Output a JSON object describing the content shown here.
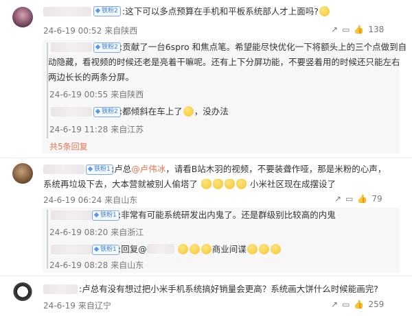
{
  "badge_label": "铁粉2",
  "badge_label_2": "铁粉1",
  "comments": [
    {
      "text": ":这下可以多点预算在手机和平板系统部人才上面吗?",
      "time": "24-6-19 00:52",
      "location": "来自陕西",
      "likes": "138"
    },
    {
      "text_prefix": ":卢总",
      "mention": "@卢伟冰",
      "text_line1": "，请看B站木羽的视频，不要装聋作哑，那是米粉的心声，",
      "text_line2": "系统再垃圾下去，大本营就被别人偷塔了",
      "text_suffix": "小米社区现在成摆设了",
      "time": "24-6-19 06:24",
      "location": "来自山东",
      "likes": "79"
    },
    {
      "text": ":卢总有没有想过把小米手机系统搞好销量会更高？系统画大饼什么时候能画完?",
      "time": "24-6-19",
      "location": "来自辽宁",
      "likes": "259"
    }
  ],
  "replies_1": [
    {
      "line1": ":贡献了一台6spro 和焦点笔。希望能尽快优化一下将额头上的三个点做到自",
      "line2": "动隐藏，看视频的时候还老是亮着干嘛呢。还有上下分屏功能，不要竖着用的时候还只能左右",
      "line3": "两边长长的两条分屏。",
      "time": "24-6-19 00:55",
      "location": "来自陕西"
    },
    {
      "text": ":都倾斜在车上了",
      "text2": "，没办法",
      "time": "24-6-19 11:28",
      "location": "来自江苏"
    }
  ],
  "more_replies": "共5条回复",
  "replies_2": [
    {
      "text": ":非常有可能系统研发出内鬼了。还是群级别比较高的内鬼",
      "time": "24-6-19 08:20",
      "location": "来自浙江"
    },
    {
      "prefix": ":回复@",
      "text": "商业间谍",
      "time": "24-6-19 08:28",
      "location": "来自山东"
    }
  ],
  "colors": {
    "link": "#eb7350",
    "badge": "#3d7fd9",
    "meta": "#777777"
  },
  "icons": [
    "share-icon",
    "comment-icon",
    "like-icon"
  ]
}
